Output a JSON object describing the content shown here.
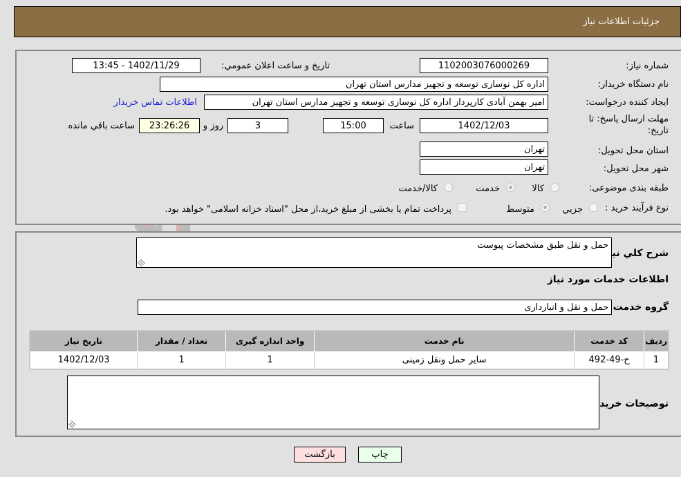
{
  "header": {
    "title": "جزئیات اطلاعات نیاز"
  },
  "form": {
    "need_number": {
      "label": "شماره نیاز:",
      "value": "1102003076000269"
    },
    "announce_datetime": {
      "label": "تاريخ و ساعت اعلان عمومي:",
      "value": "1402/11/29 - 13:45"
    },
    "buyer_org": {
      "label": "نام دستگاه خريدار:",
      "value": "اداره کل نوسازی  توسعه و تجهیز مدارس استان تهران"
    },
    "creator": {
      "label": "ايجاد کننده درخواست:",
      "value": "امیر بهمن آبادی کارپرداز اداره کل نوسازی  توسعه و تجهیز مدارس استان تهران"
    },
    "contact_link": "اطلاعات تماس خريدار",
    "deadline": {
      "label_line1": "مهلت ارسال پاسخ: تا",
      "label_line2": "تاريخ:",
      "date": "1402/12/03",
      "time_label": "ساعت",
      "time": "15:00",
      "days": "3",
      "days_label": "روز و",
      "remaining": "23:26:26",
      "remaining_label": "ساعت باقي مانده"
    },
    "province": {
      "label": "استان محل تحويل:",
      "value": "تهران"
    },
    "city": {
      "label": "شهر محل تحويل:",
      "value": "تهران"
    },
    "category": {
      "label": "طبقه بندی موضوعی:",
      "options": [
        "کالا",
        "خدمت",
        "کالا/خدمت"
      ],
      "selected": "خدمت"
    },
    "process": {
      "label": "نوع فرآيند خريد :",
      "options": [
        "جزيي",
        "متوسط"
      ],
      "selected": "متوسط",
      "checkbox_text": "پرداخت تمام يا بخشی از مبلغ خريد،از محل \"اسناد خزانه اسلامی\" خواهد بود."
    }
  },
  "details": {
    "description_label": "شرح کلي نياز:",
    "description": "حمل و نقل طبق مشخصات پیوست",
    "services_title": "اطلاعات خدمات مورد نياز",
    "service_group_label": "گروه خدمت:",
    "service_group": "حمل و نقل و انبارداری",
    "table": {
      "headers": [
        "رديف",
        "کد خدمت",
        "نام خدمت",
        "واحد اندازه گيری",
        "تعداد / مقدار",
        "تاريخ نياز"
      ],
      "rows": [
        [
          "1",
          "ح-49-492",
          "سایر حمل ونقل زمینی",
          "1",
          "1",
          "1402/12/03"
        ]
      ]
    },
    "buyer_notes_label": "توضيحات خريدار:",
    "buyer_notes": ""
  },
  "buttons": {
    "print": "چاپ",
    "back": "بازگشت"
  },
  "colors": {
    "header": "#8c6e45",
    "print_bg": "#eaffea",
    "back_bg": "#ffe0e0",
    "link": "#1a1ad6"
  },
  "watermark": "AriaTender.neT"
}
